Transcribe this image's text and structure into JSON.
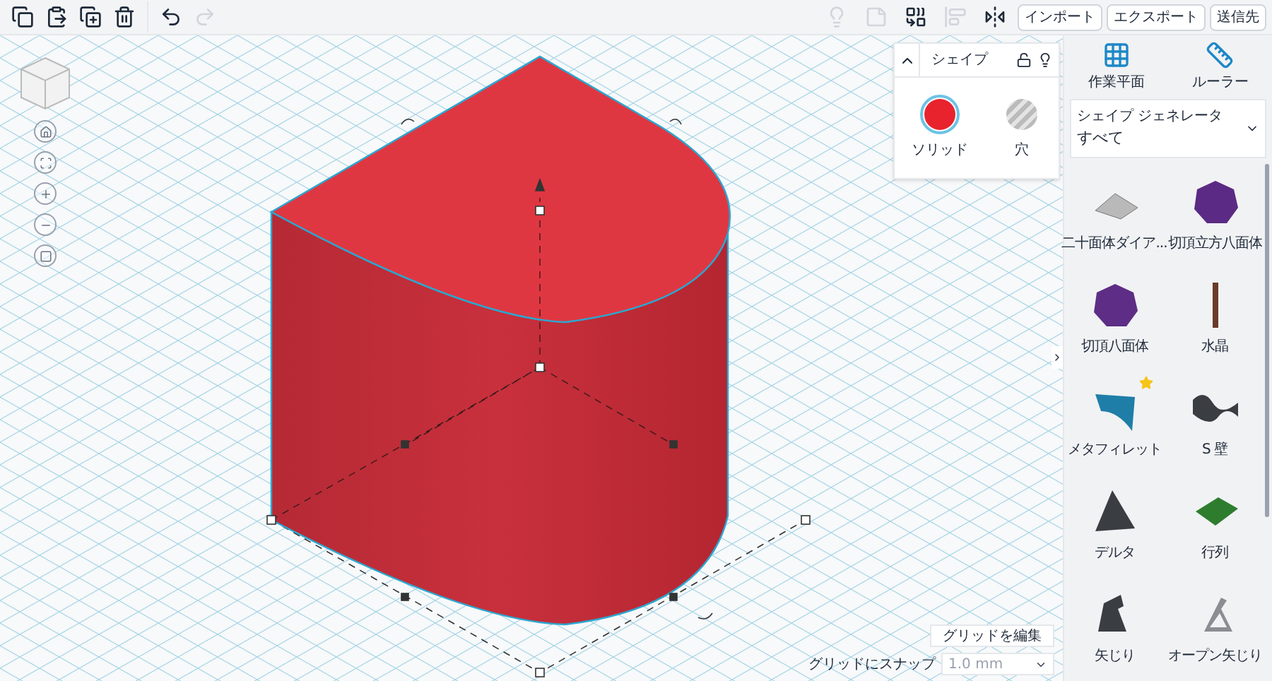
{
  "toolbar": {
    "edit_tools": [
      {
        "kind": "copy",
        "disabled": false
      },
      {
        "kind": "paste",
        "disabled": false
      },
      {
        "kind": "duplicate",
        "disabled": false
      },
      {
        "kind": "delete",
        "disabled": false
      },
      {
        "kind": "undo",
        "disabled": false
      },
      {
        "kind": "redo",
        "disabled": true
      }
    ],
    "shape_tools": [
      {
        "kind": "bulb",
        "disabled": true
      },
      {
        "kind": "note",
        "disabled": true
      },
      {
        "kind": "group",
        "disabled": false
      },
      {
        "kind": "align",
        "disabled": true
      },
      {
        "kind": "mirror",
        "disabled": false
      }
    ],
    "buttons": [
      "インポート",
      "エクスポート",
      "送信先"
    ]
  },
  "shape_panel": {
    "title": "シェイプ",
    "expanded": true,
    "locked": false,
    "options": [
      {
        "kind": "solid",
        "label": "ソリッド",
        "selected": true,
        "color": "#e8232e"
      },
      {
        "kind": "hole",
        "label": "穴",
        "selected": false
      }
    ]
  },
  "grid": {
    "edit_button": "グリッドを編集",
    "snap_label": "グリッドにスナップ",
    "snap_value": "1.0 mm"
  },
  "tools": [
    {
      "kind": "workplane",
      "label": "作業平面"
    },
    {
      "kind": "ruler",
      "label": "ルーラー"
    }
  ],
  "generator": {
    "label": "シェイプ ジェネレータ",
    "value": "すべて"
  },
  "shapes": [
    {
      "kind": "gem",
      "label": "二十面体ダイア...",
      "color": "#b9b9b9",
      "starred": false
    },
    {
      "kind": "ball",
      "label": "切頂立方八面体",
      "color": "#5b2a84",
      "starred": false
    },
    {
      "kind": "ball",
      "label": "切頂八面体",
      "color": "#5e2d86",
      "starred": false
    },
    {
      "kind": "rod",
      "label": "水晶",
      "color": "#6b3a2a",
      "starred": false
    },
    {
      "kind": "fillet",
      "label": "メタフィレット",
      "color": "#1f7ea8",
      "starred": true
    },
    {
      "kind": "wave",
      "label": "S 壁",
      "color": "#3a3d42",
      "starred": false
    },
    {
      "kind": "pyramid",
      "label": "デルタ",
      "color": "#3a3d42",
      "starred": false
    },
    {
      "kind": "grid",
      "label": "行列",
      "color": "#2e7d2e",
      "starred": false
    },
    {
      "kind": "arrow",
      "label": "矢じり",
      "color": "#3a3d42",
      "starred": false
    },
    {
      "kind": "openarrow",
      "label": "オープン矢じり",
      "color": "#8a8d92",
      "starred": false
    }
  ]
}
